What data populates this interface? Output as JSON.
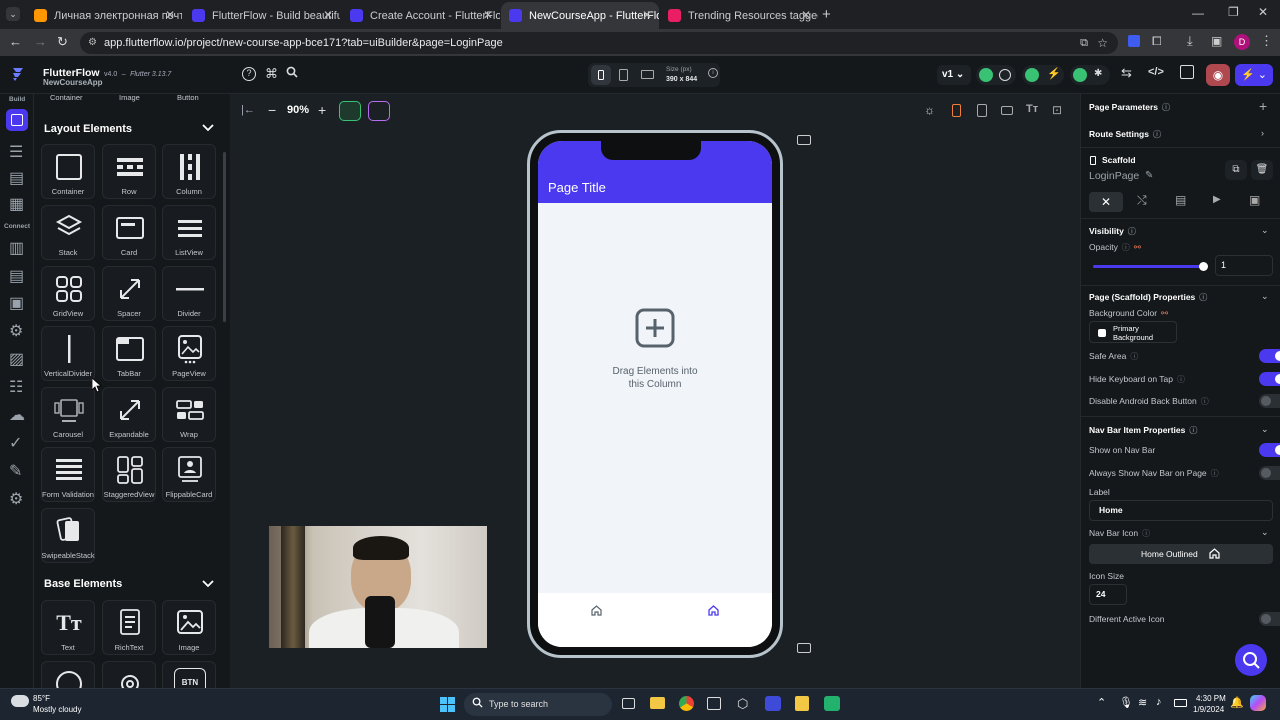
{
  "browser": {
    "tabs": [
      {
        "label": "Личная электронная почта и а",
        "color": "#ff9800",
        "active": false
      },
      {
        "label": "FlutterFlow - Build beautiful, m",
        "color": "#4b39ef",
        "active": false
      },
      {
        "label": "Create Account - FlutterFlow",
        "color": "#4b39ef",
        "active": false
      },
      {
        "label": "NewCourseApp - FlutterFlow",
        "color": "#4b39ef",
        "active": true
      },
      {
        "label": "Trending Resources tagged as",
        "color": "#e91e63",
        "active": false
      }
    ],
    "url": "app.flutterflow.io/project/new-course-app-bce171?tab=uiBuilder&page=LoginPage",
    "profile_initial": "D"
  },
  "app": {
    "name": "FlutterFlow",
    "version": "v4.0",
    "flutter_version": "Flutter 3.13.7",
    "project": "NewCourseApp",
    "size_label": "Size (px)",
    "size_value": "390 x 844",
    "branch": "v1",
    "zoom": "90%"
  },
  "rail": {
    "build_label": "Build",
    "connect_label": "Connect"
  },
  "widgets": {
    "top_row": [
      "Container",
      "Image",
      "Button"
    ],
    "layout_title": "Layout Elements",
    "layout_items": [
      "Container",
      "Row",
      "Column",
      "Stack",
      "Card",
      "ListView",
      "GridView",
      "Spacer",
      "Divider",
      "VerticalDivider",
      "TabBar",
      "PageView",
      "Carousel",
      "Expandable",
      "Wrap",
      "Form Validation",
      "StaggeredView",
      "FlippableCard",
      "SwipeableStack"
    ],
    "base_title": "Base Elements",
    "base_items": [
      "Text",
      "RichText",
      "Image",
      "",
      "",
      ""
    ]
  },
  "device": {
    "page_title": "Page Title",
    "drag_text_1": "Drag Elements into",
    "drag_text_2": "this Column",
    "appbar_color": "#4b39ef",
    "bg_color": "#f1f4f8"
  },
  "props": {
    "page_parameters": "Page Parameters",
    "route_settings": "Route Settings",
    "widget_type": "Scaffold",
    "page_name": "LoginPage",
    "visibility": "Visibility",
    "opacity_label": "Opacity",
    "opacity_value": "1",
    "opacity_fraction": 1,
    "page_props": "Page (Scaffold) Properties",
    "background_color_label": "Background Color",
    "background_color_value": "Primary Background",
    "safe_area": "Safe Area",
    "hide_keyboard": "Hide Keyboard on Tap",
    "disable_back": "Disable Android Back Button",
    "navbar_props": "Nav Bar Item Properties",
    "show_navbar": "Show on Nav Bar",
    "always_show_navbar": "Always Show Nav Bar on Page",
    "label_label": "Label",
    "label_value": "Home",
    "navbar_icon": "Nav Bar Icon",
    "icon_value": "Home Outlined",
    "icon_size_label": "Icon Size",
    "icon_size_value": "24",
    "different_active": "Different Active Icon",
    "accent": "#4b39ef"
  },
  "taskbar": {
    "temp": "85°F",
    "weather": "Mostly cloudy",
    "search_placeholder": "Type to search",
    "time": "4:30 PM",
    "date": "1/9/2024"
  }
}
